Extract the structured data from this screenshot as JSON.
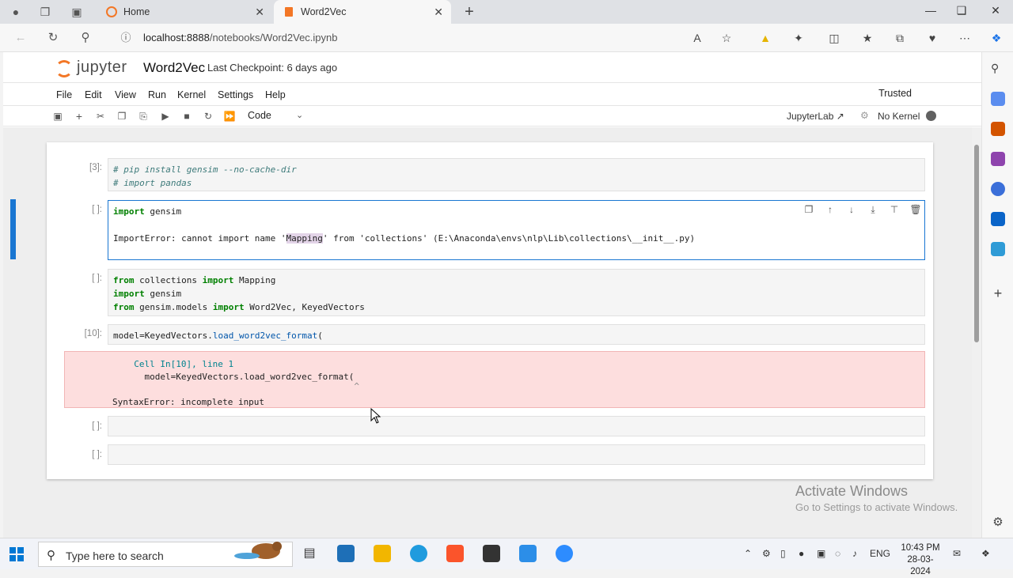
{
  "browser": {
    "tabs": [
      {
        "label": "Home",
        "active": false
      },
      {
        "label": "Word2Vec",
        "active": true
      }
    ],
    "url_host": "localhost:8888",
    "url_path": "/notebooks/Word2Vec.ipynb"
  },
  "jupyter": {
    "logo_text": "jupyter",
    "notebook_title": "Word2Vec",
    "checkpoint": "Last Checkpoint: 6 days ago",
    "menu": [
      "File",
      "Edit",
      "View",
      "Run",
      "Kernel",
      "Settings",
      "Help"
    ],
    "trusted": "Trusted",
    "cell_type": "Code",
    "jupyterlab_link": "JupyterLab",
    "kernel_status": "No Kernel"
  },
  "cells": [
    {
      "prompt": "[3]:",
      "lines": [
        "# pip install gensim --no-cache-dir",
        "# import pandas"
      ]
    },
    {
      "prompt": "[ ]:",
      "lines": [
        "import gensim"
      ],
      "error": [
        "ImportError: cannot import name '",
        "Mapping",
        "' from 'collections' (E:\\Anaconda\\envs\\nlp\\Lib\\collections\\__init__.py)"
      ]
    },
    {
      "prompt": "[ ]:",
      "lines": [
        "from collections import Mapping",
        "import gensim",
        "from gensim.models import Word2Vec, KeyedVectors"
      ]
    },
    {
      "prompt": "[10]:",
      "lines": [
        "model=KeyedVectors.load_word2vec_format("
      ]
    },
    {
      "prompt": "[ ]:",
      "lines": [
        ""
      ]
    },
    {
      "prompt": "[ ]:",
      "lines": [
        ""
      ]
    }
  ],
  "traceback": {
    "line1": "  Cell In[10], line 1",
    "line2": "    model=KeyedVectors.load_word2vec_format(",
    "line3": "                                            ^",
    "line4": "SyntaxError: incomplete input"
  },
  "watermark": {
    "title": "Activate Windows",
    "subtitle": "Go to Settings to activate Windows."
  },
  "taskbar": {
    "search_placeholder": "Type here to search",
    "lang": "ENG",
    "time": "10:43 PM",
    "date": "28-03-2024"
  }
}
